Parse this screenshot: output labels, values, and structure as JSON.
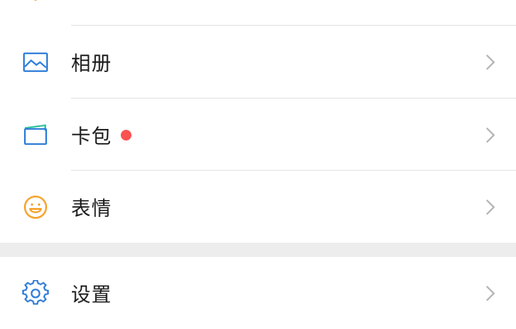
{
  "menu": {
    "top_partial": {
      "icon": "orange-shield-icon"
    },
    "items": [
      {
        "label": "相册",
        "icon": "album-icon",
        "badge": false
      },
      {
        "label": "卡包",
        "icon": "card-wallet-icon",
        "badge": true
      },
      {
        "label": "表情",
        "icon": "emoji-icon",
        "badge": false
      }
    ],
    "settings": {
      "label": "设置",
      "icon": "gear-icon"
    }
  },
  "colors": {
    "accent_blue": "#2b7bd8",
    "badge_red": "#fa5151",
    "emoji_orange": "#f7a22b",
    "card_green": "#25c09d",
    "chevron_gray": "#b2b2b2"
  }
}
